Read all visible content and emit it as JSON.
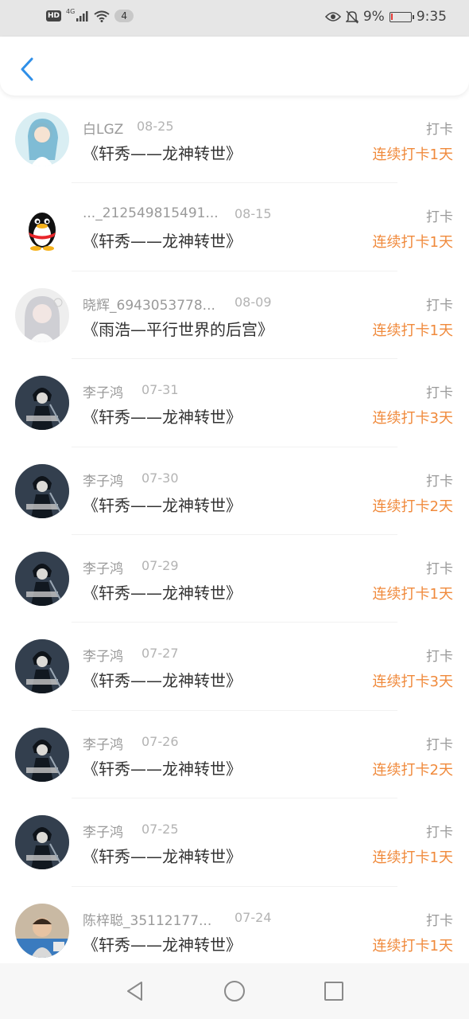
{
  "status_bar": {
    "indicator": "HD",
    "network": "4G",
    "notification_count": "4",
    "battery_percent": "9%",
    "battery_level": 0.09,
    "time": "9:35"
  },
  "header": {
    "back_icon": "chevron-left-icon",
    "accent_color": "#2f8fe8"
  },
  "colors": {
    "streak": "#f08a3c",
    "meta": "#9a9a9a"
  },
  "records": [
    {
      "name": "白LGZ",
      "date": "08-25",
      "book": "《轩秀——龙神转世》",
      "type": "打卡",
      "streak": "连续打卡1天"
    },
    {
      "name": "..._212549815491...",
      "date": "08-15",
      "book": "《轩秀——龙神转世》",
      "type": "打卡",
      "streak": "连续打卡1天"
    },
    {
      "name": "晓辉_6943053778...",
      "date": "08-09",
      "book": "《雨浩—平行世界的后宫》",
      "type": "打卡",
      "streak": "连续打卡1天"
    },
    {
      "name": "李子鸿",
      "date": "07-31",
      "book": "《轩秀——龙神转世》",
      "type": "打卡",
      "streak": "连续打卡3天"
    },
    {
      "name": "李子鸿",
      "date": "07-30",
      "book": "《轩秀——龙神转世》",
      "type": "打卡",
      "streak": "连续打卡2天"
    },
    {
      "name": "李子鸿",
      "date": "07-29",
      "book": "《轩秀——龙神转世》",
      "type": "打卡",
      "streak": "连续打卡1天"
    },
    {
      "name": "李子鸿",
      "date": "07-27",
      "book": "《轩秀——龙神转世》",
      "type": "打卡",
      "streak": "连续打卡3天"
    },
    {
      "name": "李子鸿",
      "date": "07-26",
      "book": "《轩秀——龙神转世》",
      "type": "打卡",
      "streak": "连续打卡2天"
    },
    {
      "name": "李子鸿",
      "date": "07-25",
      "book": "《轩秀——龙神转世》",
      "type": "打卡",
      "streak": "连续打卡1天"
    },
    {
      "name": "陈梓聪_35112177...",
      "date": "07-24",
      "book": "《轩秀——龙神转世》",
      "type": "打卡",
      "streak": "连续打卡1天"
    }
  ],
  "nav_bar": {
    "back": "triangle-back-icon",
    "home": "circle-home-icon",
    "recents": "square-recents-icon"
  }
}
